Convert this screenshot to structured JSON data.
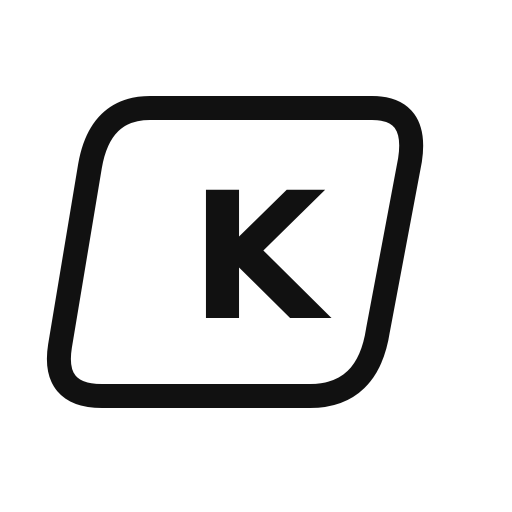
{
  "icon": {
    "name": "keyboard-key-icon",
    "letter": "K",
    "stroke_color": "#111111",
    "background": "#ffffff"
  }
}
